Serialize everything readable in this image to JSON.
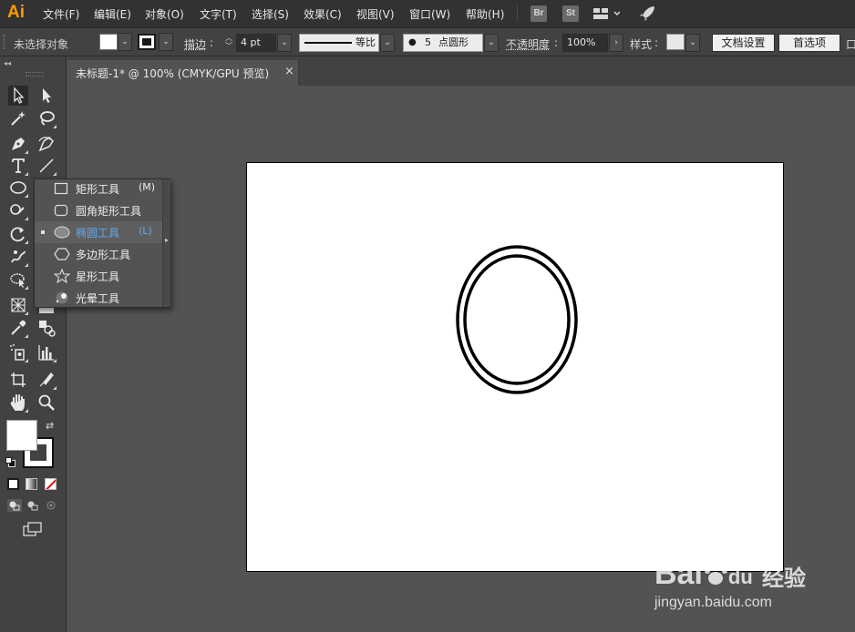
{
  "app": {
    "logo_text": "Ai",
    "accent_color": "#ff9a00"
  },
  "menubar": {
    "items": [
      "文件(F)",
      "编辑(E)",
      "对象(O)",
      "文字(T)",
      "选择(S)",
      "效果(C)",
      "视图(V)",
      "窗口(W)",
      "帮助(H)"
    ],
    "badges": [
      "Br",
      "St"
    ]
  },
  "controlbar": {
    "selection_status": "未选择对象",
    "stroke_label": "描边",
    "stroke_weight": "4 pt",
    "stroke_profile": "等比",
    "brush_dot": "●",
    "brush_size": "5",
    "brush_label": "点圆形",
    "opacity_label": "不透明度",
    "opacity_value": "100%",
    "style_label": "样式",
    "doc_setup_label": "文档设置",
    "prefs_label": "首选项",
    "overflow_text": "口"
  },
  "document": {
    "tab_title": "未标题-1* @ 100% (CMYK/GPU 预览)",
    "close_glyph": "×"
  },
  "flyout": {
    "items": [
      {
        "label": "矩形工具",
        "shortcut": "(M)",
        "icon": "rectangle-icon",
        "selected": false
      },
      {
        "label": "圆角矩形工具",
        "shortcut": "",
        "icon": "rounded-rectangle-icon",
        "selected": false
      },
      {
        "label": "椭圆工具",
        "shortcut": "(L)",
        "icon": "ellipse-icon",
        "selected": true
      },
      {
        "label": "多边形工具",
        "shortcut": "",
        "icon": "polygon-icon",
        "selected": false
      },
      {
        "label": "星形工具",
        "shortcut": "",
        "icon": "star-icon",
        "selected": false
      },
      {
        "label": "光晕工具",
        "shortcut": "",
        "icon": "flare-icon",
        "selected": false
      }
    ],
    "selected_color": "#5da9f0"
  },
  "watermark": {
    "brand": "Bai",
    "brand_suffix": "du",
    "jingyan": "经验",
    "url": "jingyan.baidu.com"
  },
  "colors": {
    "workspace": "#535353",
    "panel": "#424242",
    "menubar": "#323232",
    "artboard": "#ffffff"
  }
}
